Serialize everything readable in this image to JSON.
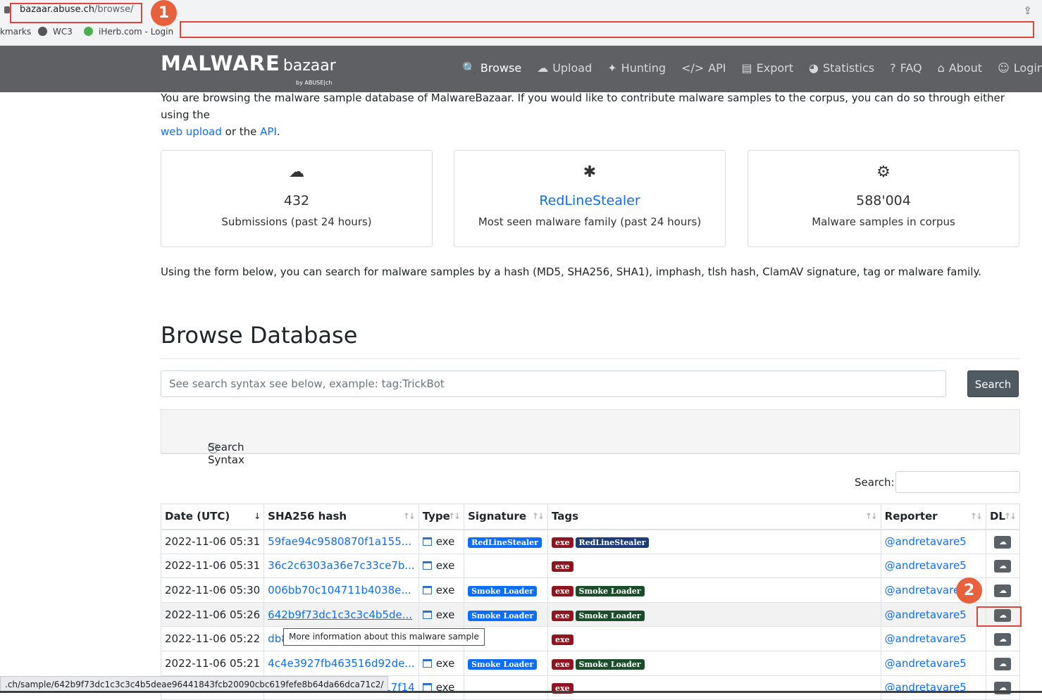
{
  "browser": {
    "url_host": "bazaar.abuse.ch",
    "url_path": "/browse/",
    "bookmarks": [
      {
        "label": "kmarks"
      },
      {
        "label": "WC3"
      },
      {
        "label": "iHerb.com - Login"
      }
    ],
    "annotation_1": "1",
    "annotation_2": "2",
    "status_url": ".ch/sample/642b9f73dc1c3c3c4b5deae96441843fcb20090cbc619fefe8b64da66dca71c2/"
  },
  "logo": {
    "main": "MALWARE",
    "sub": "bazaar",
    "by": "by ABUSE|ch"
  },
  "nav": [
    {
      "icon": "search-icon",
      "label": "Browse"
    },
    {
      "icon": "cloud-upload-icon",
      "label": "Upload"
    },
    {
      "icon": "hunting-icon",
      "label": "Hunting"
    },
    {
      "icon": "code-icon",
      "label": "API"
    },
    {
      "icon": "export-icon",
      "label": "Export"
    },
    {
      "icon": "pie-chart-icon",
      "label": "Statistics"
    },
    {
      "icon": "question-icon",
      "label": "FAQ"
    },
    {
      "icon": "building-icon",
      "label": "About"
    },
    {
      "icon": "user-icon",
      "label": "Login"
    }
  ],
  "intro": {
    "text1": "You are browsing the malware sample database of MalwareBazaar. If you would like to contribute malware samples to the corpus, you can do so through either using the",
    "link1": "web upload",
    "text2": "or the",
    "link2": "API",
    "text3": "."
  },
  "cards": [
    {
      "icon": "cloud-upload-icon",
      "value": "432",
      "label": "Submissions (past 24 hours)"
    },
    {
      "icon": "bug-icon",
      "value": "RedLineStealer",
      "label": "Most seen malware family (past 24 hours)"
    },
    {
      "icon": "gears-icon",
      "value": "588'004",
      "label": "Malware samples in corpus"
    }
  ],
  "description": "Using the form below, you can search for malware samples by a hash (MD5, SHA256, SHA1), imphash, tlsh hash, ClamAV signature, tag or malware family.",
  "heading": "Browse Database",
  "search": {
    "placeholder": "See search syntax see below, example: tag:TrickBot",
    "button": "Search"
  },
  "syntax_label": "Search Syntax",
  "table_search_label": "Search:",
  "table": {
    "headers": [
      "Date (UTC)",
      "SHA256 hash",
      "Type",
      "Signature",
      "Tags",
      "Reporter",
      "DL"
    ],
    "rows": [
      {
        "date": "2022-11-06 05:31",
        "hash": "59fae94c9580870f1a155...",
        "type": "exe",
        "signature": "RedLineStealer",
        "tags": [
          "exe",
          "RedLineStealer"
        ],
        "reporter": "@andretavare5"
      },
      {
        "date": "2022-11-06 05:31",
        "hash": "36c2c6303a36e7c33ce7b...",
        "type": "exe",
        "signature": "",
        "tags": [
          "exe"
        ],
        "reporter": "@andretavare5"
      },
      {
        "date": "2022-11-06 05:30",
        "hash": "006bb70c104711b4038e...",
        "type": "exe",
        "signature": "Smoke Loader",
        "tags": [
          "exe",
          "Smoke Loader"
        ],
        "reporter": "@andretavare5"
      },
      {
        "date": "2022-11-06 05:26",
        "hash": "642b9f73dc1c3c3c4b5de...",
        "type": "exe",
        "signature": "Smoke Loader",
        "tags": [
          "exe",
          "Smoke Loader"
        ],
        "reporter": "@andretavare5"
      },
      {
        "date": "2022-11-06 05:22",
        "hash": "db8...",
        "type": "",
        "signature": "",
        "tags": [
          "exe"
        ],
        "reporter": "@andretavare5"
      },
      {
        "date": "2022-11-06 05:21",
        "hash": "4c4e3927fb463516d92de...",
        "type": "exe",
        "signature": "Smoke Loader",
        "tags": [
          "exe",
          "Smoke Loader"
        ],
        "reporter": "@andretavare5"
      },
      {
        "date": "",
        "hash": "f47417f14",
        "type": "exe",
        "signature": "",
        "tags": [
          "exe"
        ],
        "reporter": "@andretavare5"
      }
    ]
  },
  "tooltip": "More information about this malware sample"
}
